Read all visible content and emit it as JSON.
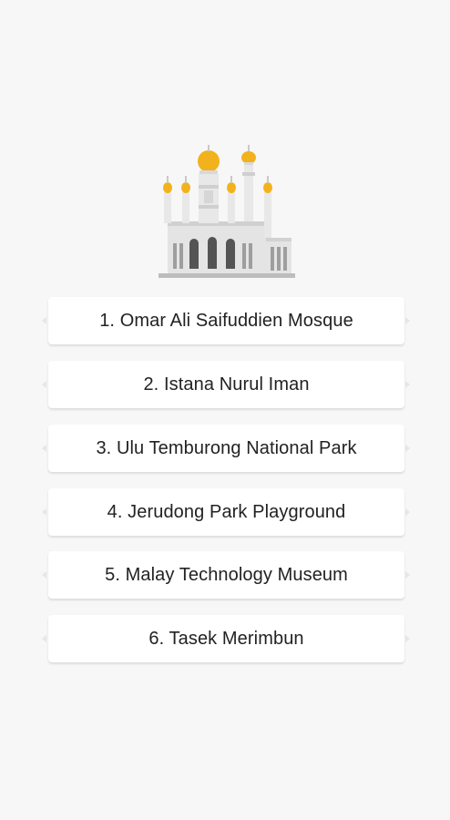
{
  "logo": {
    "icon": "mosque-icon",
    "colors": {
      "dome": "#f2b21d",
      "wall": "#e4e4e4",
      "wall_shade": "#c9c9c9",
      "window": "#545454",
      "base": "#bdbdbd"
    }
  },
  "items": [
    {
      "label": "1. Omar Ali Saifuddien Mosque"
    },
    {
      "label": "2. Istana Nurul Iman"
    },
    {
      "label": "3. Ulu Temburong National Park"
    },
    {
      "label": "4. Jerudong Park Playground"
    },
    {
      "label": "5. Malay Technology Museum"
    },
    {
      "label": "6. Tasek Merimbun"
    }
  ],
  "colors": {
    "background": "#f7f7f7",
    "card": "#ffffff",
    "text": "#222222"
  }
}
